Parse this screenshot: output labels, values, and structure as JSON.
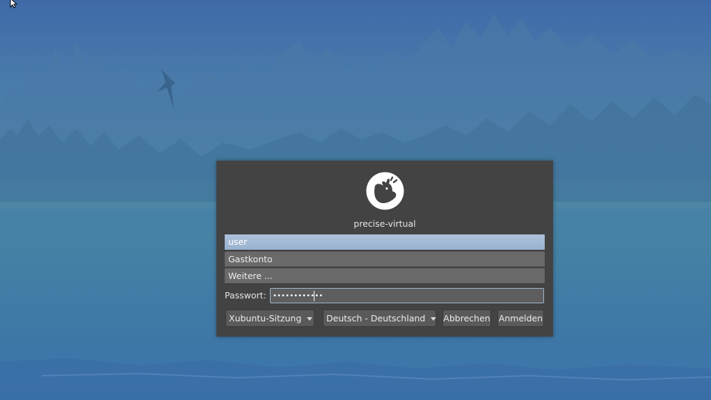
{
  "login": {
    "hostname": "precise-virtual",
    "users": [
      {
        "label": "user",
        "selected": true
      },
      {
        "label": "Gastkonto",
        "selected": false
      },
      {
        "label": "Weitere ...",
        "selected": false
      }
    ],
    "password_label": "Passwort:",
    "password_value": "••••••••••••"
  },
  "controls": {
    "session": "Xubuntu-Sitzung",
    "language": "Deutsch - Deutschland",
    "cancel": "Abbrechen",
    "login": "Anmelden"
  },
  "colors": {
    "dialog_bg": "#434343",
    "selected_item": "#a9bfd9",
    "item_bg": "#6a6a6a"
  },
  "icons": {
    "logo": "xfce-mouse-logo",
    "cursor": "mouse-pointer-icon"
  }
}
